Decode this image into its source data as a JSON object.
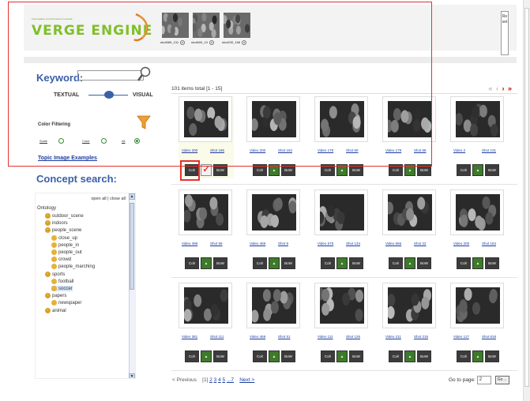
{
  "header": {
    "logo_tagline": "Information & Informatics Institute",
    "logo_text": "VERGE ENGINE",
    "selected_shots": [
      {
        "label": "shot589_131"
      },
      {
        "label": "shot600_13"
      },
      {
        "label": "shot230_168"
      }
    ],
    "reset_label": "Reset"
  },
  "search": {
    "keyword_label": "Keyword:",
    "keyword_value": "",
    "textual_label": "TEXTUAL",
    "visual_label": "VISUAL",
    "color_filtering_label": "Color Filtering",
    "color_options": [
      {
        "label": "Scale",
        "selected": false
      },
      {
        "label": "Color",
        "selected": false
      },
      {
        "label": "All",
        "selected": true
      }
    ],
    "topic_examples_link": "Topic Image Examples",
    "concept_search_label": "Concept search:"
  },
  "tree": {
    "open_close": "open all | close all",
    "root": "Ontology",
    "nodes": [
      {
        "label": "outdoor_scene",
        "depth": 1,
        "leaf": false
      },
      {
        "label": "indoors",
        "depth": 1,
        "leaf": false
      },
      {
        "label": "people_scene",
        "depth": 1,
        "leaf": false
      },
      {
        "label": "close_up",
        "depth": 2,
        "leaf": true
      },
      {
        "label": "people_in",
        "depth": 2,
        "leaf": true
      },
      {
        "label": "people_out",
        "depth": 2,
        "leaf": true
      },
      {
        "label": "crowd",
        "depth": 2,
        "leaf": true
      },
      {
        "label": "people_marching",
        "depth": 2,
        "leaf": true
      },
      {
        "label": "sports",
        "depth": 1,
        "leaf": false
      },
      {
        "label": "football",
        "depth": 2,
        "leaf": true
      },
      {
        "label": "soccer",
        "depth": 2,
        "leaf": true,
        "highlighted": true
      },
      {
        "label": "papers",
        "depth": 1,
        "leaf": false
      },
      {
        "label": "newspaper",
        "depth": 2,
        "leaf": true
      },
      {
        "label": "animal",
        "depth": 1,
        "leaf": false
      }
    ]
  },
  "results": {
    "summary": "101 items total [1 - 15]",
    "button_labels": {
      "colr": "Colr",
      "bow": "BoW"
    },
    "items": [
      {
        "video": "Video 200",
        "shot": "Shot 166",
        "selected": true
      },
      {
        "video": "Video 200",
        "shot": "Shot 162"
      },
      {
        "video": "Video 178",
        "shot": "Shot 60"
      },
      {
        "video": "Video 178",
        "shot": "Shot 58"
      },
      {
        "video": "Video 2",
        "shot": "Shot 131"
      },
      {
        "video": "Video 498",
        "shot": "Shot 59"
      },
      {
        "video": "Video 469",
        "shot": "Shot 9"
      },
      {
        "video": "Video 578",
        "shot": "Shot 134"
      },
      {
        "video": "Video 556",
        "shot": "Shot 22"
      },
      {
        "video": "Video 200",
        "shot": "Shot 164"
      },
      {
        "video": "Video 381",
        "shot": "Shot 111"
      },
      {
        "video": "Video 469",
        "shot": "Shot 51"
      },
      {
        "video": "Video 111",
        "shot": "Shot 126"
      },
      {
        "video": "Video 211",
        "shot": "Shot 216"
      },
      {
        "video": "Video 117",
        "shot": "Shot 618"
      }
    ]
  },
  "pagination": {
    "previous": "< Previous",
    "current": "[1]",
    "pages": [
      "2",
      "3",
      "4",
      "5",
      "...7"
    ],
    "next": "Next >",
    "goto_label": "Go to page:",
    "goto_value": "2",
    "goto_button": "Go"
  },
  "colors": {
    "accent_blue": "#3a5fa8",
    "logo_green": "#7fbf2a",
    "annotation_red": "#e53030"
  }
}
